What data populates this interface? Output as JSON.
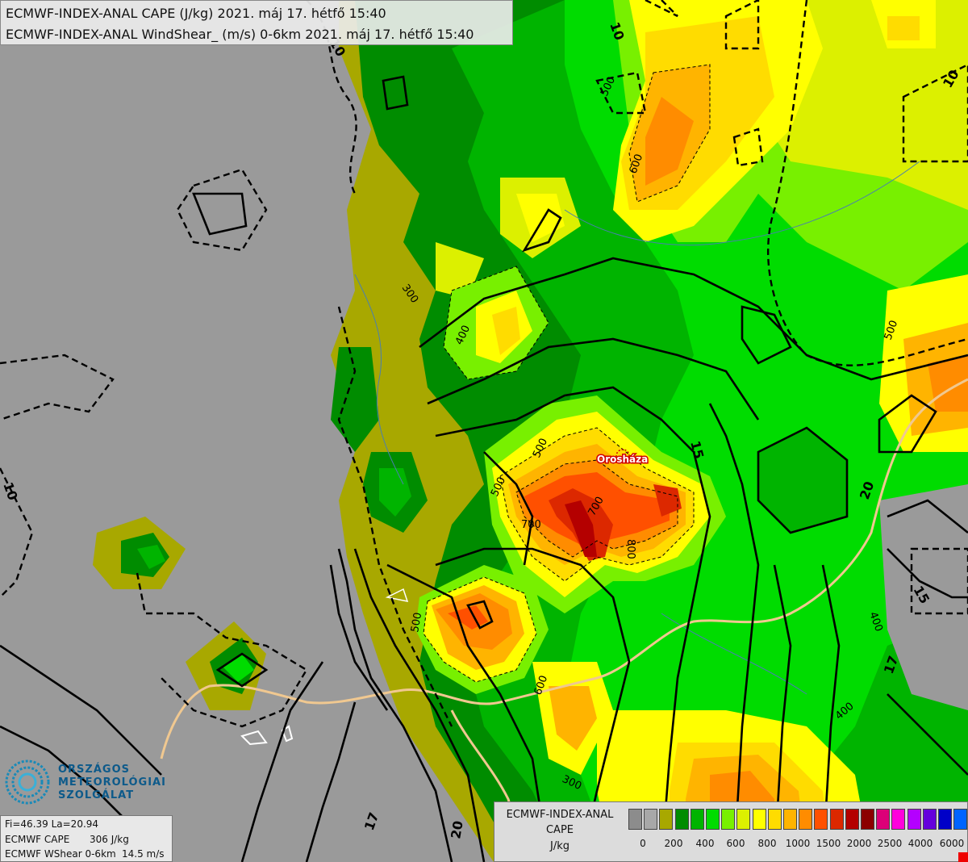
{
  "header": {
    "line1": "ECMWF-INDEX-ANAL CAPE (J/kg) 2021. máj 17. hétfő 15:40",
    "line2": "ECMWF-INDEX-ANAL WindShear_ (m/s) 0-6km 2021. máj 17. hétfő 15:40"
  },
  "map": {
    "city_label": "Orosháza",
    "cape_labels": [
      "300",
      "400",
      "500",
      "500",
      "500",
      "600",
      "600",
      "600",
      "700",
      "800",
      "500",
      "400",
      "300",
      "400",
      "500",
      "700"
    ],
    "shear_labels": [
      "10",
      "10",
      "10",
      "15",
      "15",
      "17",
      "17",
      "20",
      "20",
      "10"
    ]
  },
  "logo": {
    "line1": "ORSZÁGOS",
    "line2": "METEOROLÓGIAI",
    "line3": "SZOLGÁLAT"
  },
  "readout": {
    "coords": "Fi=46.39 La=20.94",
    "cape_label": "ECMWF CAPE",
    "cape_value": "306 J/kg",
    "shear_label": "ECMWF WShear 0-6km",
    "shear_value": "14.5 m/s"
  },
  "legend": {
    "title1": "ECMWF-INDEX-ANAL",
    "title2": "CAPE",
    "title3": "J/kg",
    "colors": [
      "#8c8c8c",
      "#a8a8a8",
      "#a8a800",
      "#008c00",
      "#00b400",
      "#00dc00",
      "#78f000",
      "#dcf000",
      "#ffff00",
      "#ffdc00",
      "#ffb400",
      "#ff8c00",
      "#ff5000",
      "#dc2800",
      "#b40000",
      "#8c0000",
      "#dc0078",
      "#ff00dc",
      "#b400ff",
      "#6400dc",
      "#0000c8",
      "#0064ff",
      "#00b4ff",
      "#00f0ff",
      "#ffffff"
    ],
    "ticks": [
      "0",
      "200",
      "400",
      "600",
      "800",
      "1000",
      "1500",
      "2000",
      "2500",
      "4000",
      "6000"
    ]
  }
}
